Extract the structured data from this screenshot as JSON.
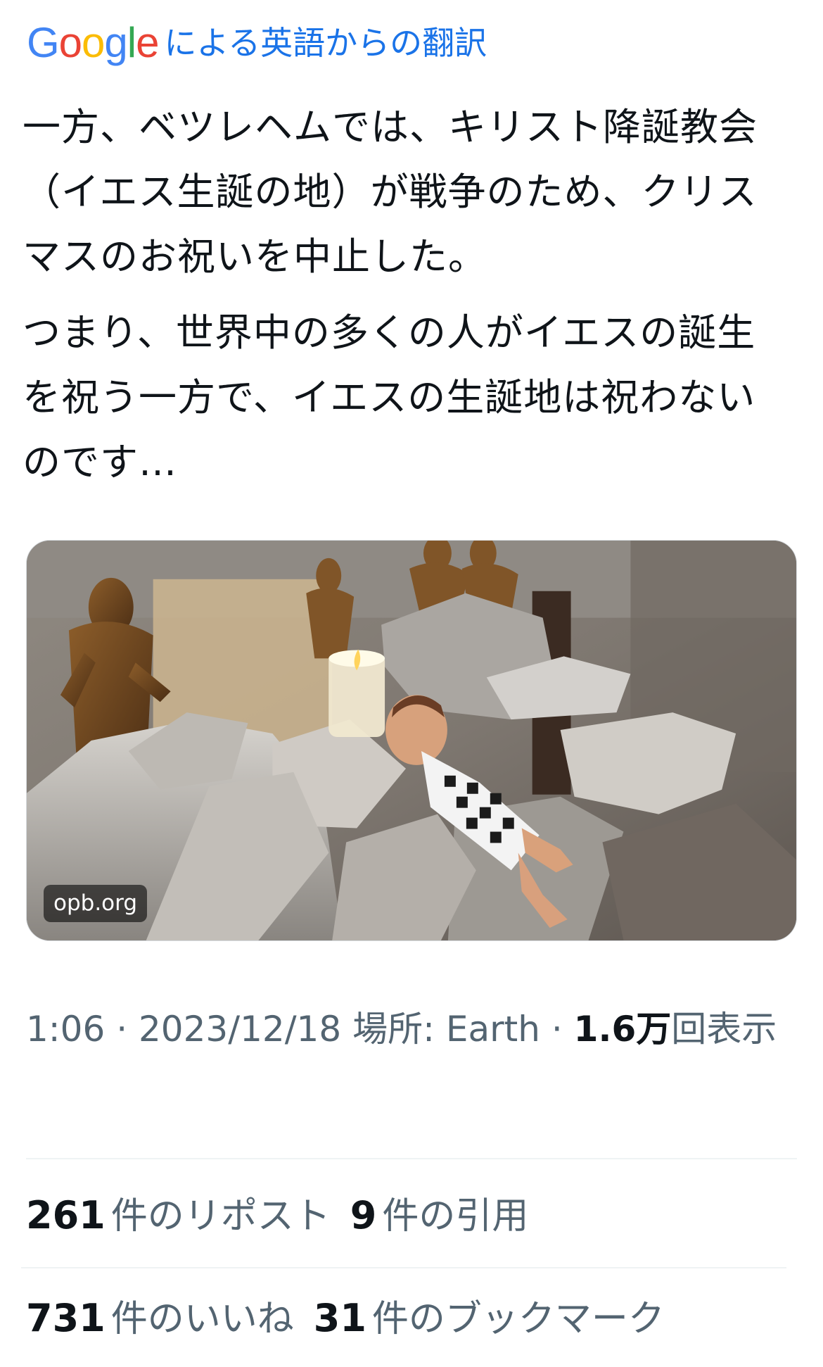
{
  "translation": {
    "brand": "Google",
    "label": "による英語からの翻訳"
  },
  "tweet": {
    "paragraphs": [
      "一方、ベツレヘムでは、キリスト降誕教会（イエス生誕の地）が戦争のため、クリスマスのお祝いを中止した。",
      "つまり、世界中の多くの人がイエスの誕生を祝う一方で、イエスの生誕地は祝わないのです…"
    ]
  },
  "media": {
    "domain": "opb.org"
  },
  "meta": {
    "time": "1:06",
    "separator": "·",
    "date": "2023/12/18",
    "location_prefix": "場所:",
    "location": "Earth",
    "views_value": "1.6万",
    "views_label": "回表示"
  },
  "stats": {
    "reposts_value": "261",
    "reposts_label": "件のリポスト",
    "quotes_value": "9",
    "quotes_label": "件の引用",
    "likes_value": "731",
    "likes_label": "件のいいね",
    "bookmarks_value": "31",
    "bookmarks_label": "件のブックマーク"
  },
  "colors": {
    "google_blue": "#4285F4",
    "google_red": "#EA4335",
    "google_yellow": "#FBBC05",
    "google_green": "#34A853",
    "translation_blue": "#1a73e8",
    "text_primary": "#0f1419",
    "text_secondary": "#536471",
    "divider": "#eff3f4"
  },
  "icons": {
    "google_logo": "google-logo"
  }
}
